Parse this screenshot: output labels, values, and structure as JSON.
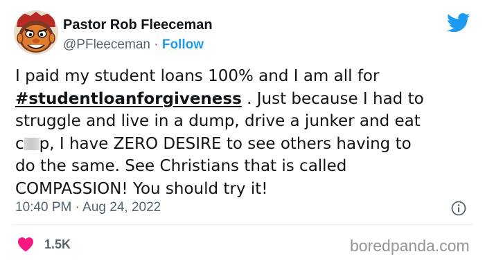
{
  "author": {
    "display_name": "Pastor Rob Fleeceman",
    "handle": "@PFleeceman",
    "separator": " · ",
    "follow_label": "Follow",
    "avatar_icon": "cartoon-face-avatar"
  },
  "brand": {
    "icon": "twitter-bird-icon",
    "color": "#1d9bf0"
  },
  "tweet": {
    "line1": "I paid my student loans 100% and I am all for",
    "hashtag": "#studentloanforgiveness",
    "line2_rest": " . Just because I had to",
    "line3": "struggle and live in a dump, drive a junker and eat",
    "line4_start": "c",
    "line4_after_censor": "p, I have ZERO DESIRE to see others having to",
    "line5": "do the same.  See Christians that is called",
    "line6": "COMPASSION! You should try it!"
  },
  "meta": {
    "timestamp": "10:40 PM · Aug 24, 2022",
    "info_icon": "info-icon"
  },
  "engagement": {
    "like_icon": "heart-icon",
    "like_color": "#f91880",
    "like_count": "1.5K"
  },
  "watermark": {
    "text": "boredpanda.com"
  }
}
